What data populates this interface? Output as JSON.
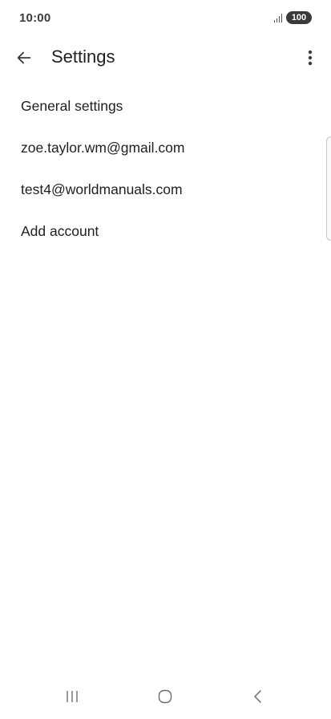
{
  "status_bar": {
    "time": "10:00",
    "battery": "100",
    "icons": [
      "signal-icon",
      "battery-icon"
    ]
  },
  "app_bar": {
    "title": "Settings",
    "back_icon": "arrow-left-icon",
    "more_icon": "more-vert-icon"
  },
  "settings": {
    "items": [
      {
        "label": "General settings"
      },
      {
        "label": "zoe.taylor.wm@gmail.com"
      },
      {
        "label": "test4@worldmanuals.com"
      },
      {
        "label": "Add account"
      }
    ]
  },
  "nav_bar": {
    "icons": [
      "recents-icon",
      "home-icon",
      "back-icon"
    ]
  },
  "colors": {
    "text": "#1f1f1f",
    "background": "#ffffff",
    "battery_bg": "#3a3a3a"
  }
}
